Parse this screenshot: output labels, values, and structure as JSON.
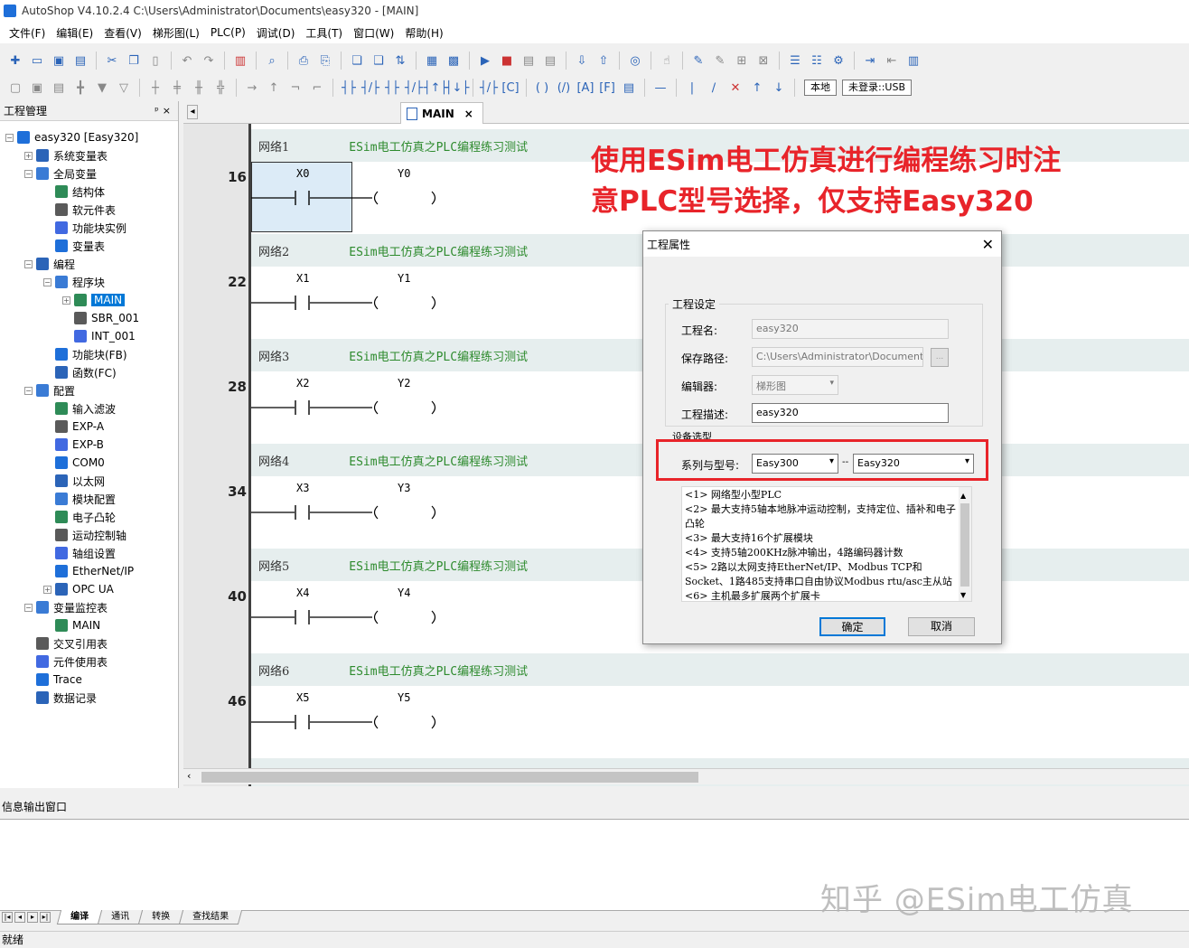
{
  "window": {
    "title": "AutoShop V4.10.2.4  C:\\Users\\Administrator\\Documents\\easy320 - [MAIN]"
  },
  "menu": [
    "文件(F)",
    "编辑(E)",
    "查看(V)",
    "梯形图(L)",
    "PLC(P)",
    "调试(D)",
    "工具(T)",
    "窗口(W)",
    "帮助(H)"
  ],
  "toolbar": {
    "local_label": "本地",
    "login_label": "未登录::USB"
  },
  "project_panel": {
    "title": "工程管理",
    "pin": "ᵖ",
    "close": "×",
    "tree": [
      {
        "label": "easy320 [Easy320]",
        "depth": 0,
        "exp": "−"
      },
      {
        "label": "系统变量表",
        "depth": 1,
        "exp": "+"
      },
      {
        "label": "全局变量",
        "depth": 1,
        "exp": "−"
      },
      {
        "label": "结构体",
        "depth": 2,
        "exp": ""
      },
      {
        "label": "软元件表",
        "depth": 2,
        "exp": ""
      },
      {
        "label": "功能块实例",
        "depth": 2,
        "exp": ""
      },
      {
        "label": "变量表",
        "depth": 2,
        "exp": ""
      },
      {
        "label": "编程",
        "depth": 1,
        "exp": "−"
      },
      {
        "label": "程序块",
        "depth": 2,
        "exp": "−"
      },
      {
        "label": "MAIN",
        "depth": 3,
        "exp": "+",
        "selected": true
      },
      {
        "label": "SBR_001",
        "depth": 3,
        "exp": ""
      },
      {
        "label": "INT_001",
        "depth": 3,
        "exp": ""
      },
      {
        "label": "功能块(FB)",
        "depth": 2,
        "exp": ""
      },
      {
        "label": "函数(FC)",
        "depth": 2,
        "exp": ""
      },
      {
        "label": "配置",
        "depth": 1,
        "exp": "−"
      },
      {
        "label": "输入滤波",
        "depth": 2,
        "exp": ""
      },
      {
        "label": "EXP-A",
        "depth": 2,
        "exp": ""
      },
      {
        "label": "EXP-B",
        "depth": 2,
        "exp": ""
      },
      {
        "label": "COM0",
        "depth": 2,
        "exp": ""
      },
      {
        "label": "以太网",
        "depth": 2,
        "exp": ""
      },
      {
        "label": "模块配置",
        "depth": 2,
        "exp": ""
      },
      {
        "label": "电子凸轮",
        "depth": 2,
        "exp": ""
      },
      {
        "label": "运动控制轴",
        "depth": 2,
        "exp": ""
      },
      {
        "label": "轴组设置",
        "depth": 2,
        "exp": ""
      },
      {
        "label": "EtherNet/IP",
        "depth": 2,
        "exp": ""
      },
      {
        "label": "OPC UA",
        "depth": 2,
        "exp": "+"
      },
      {
        "label": "变量监控表",
        "depth": 1,
        "exp": "−"
      },
      {
        "label": "MAIN",
        "depth": 2,
        "exp": ""
      },
      {
        "label": "交叉引用表",
        "depth": 1,
        "exp": ""
      },
      {
        "label": "元件使用表",
        "depth": 1,
        "exp": ""
      },
      {
        "label": "Trace",
        "depth": 1,
        "exp": ""
      },
      {
        "label": "数据记录",
        "depth": 1,
        "exp": ""
      }
    ]
  },
  "editor": {
    "tab_label": "MAIN",
    "tab_close": "×",
    "nav_arrow": "◂",
    "networks": [
      {
        "name": "网络1",
        "comment": "ESim电工仿真之PLC编程练习测试",
        "line": "16",
        "contact": "X0",
        "coil": "Y0",
        "selected": true
      },
      {
        "name": "网络2",
        "comment": "ESim电工仿真之PLC编程练习测试",
        "line": "22",
        "contact": "X1",
        "coil": "Y1"
      },
      {
        "name": "网络3",
        "comment": "ESim电工仿真之PLC编程练习测试",
        "line": "28",
        "contact": "X2",
        "coil": "Y2"
      },
      {
        "name": "网络4",
        "comment": "ESim电工仿真之PLC编程练习测试",
        "line": "34",
        "contact": "X3",
        "coil": "Y3"
      },
      {
        "name": "网络5",
        "comment": "ESim电工仿真之PLC编程练习测试",
        "line": "40",
        "contact": "X4",
        "coil": "Y4"
      },
      {
        "name": "网络6",
        "comment": "ESim电工仿真之PLC编程练习测试",
        "line": "46",
        "contact": "X5",
        "coil": "Y5"
      }
    ]
  },
  "annotation": {
    "line1": "使用ESim电工仿真进行编程练习时注",
    "line2": "意PLC型号选择，仅支持Easy320",
    "color": "#e8242a"
  },
  "dialog": {
    "title": "工程属性",
    "close": "✕",
    "group_label": "工程设定",
    "name_label": "工程名:",
    "name_value": "easy320",
    "path_label": "保存路径:",
    "path_value": "C:\\Users\\Administrator\\Documents\\ea",
    "browse_label": "...",
    "editor_label": "编辑器:",
    "editor_value": "梯形图",
    "desc_label": "工程描述:",
    "desc_value": "easy320",
    "device_label": "设备选型",
    "series_label": "系列与型号:",
    "series_value": "Easy300",
    "sep": "--",
    "model_value": "Easy320",
    "features": [
      "<1> 网络型小型PLC",
      "<2> 最大支持5轴本地脉冲运动控制，支持定位、插补和电子凸轮",
      "<3> 最大支持16个扩展模块",
      "<4> 支持5轴200KHz脉冲输出，4路编码器计数",
      "<5> 2路以太网支持EtherNet/IP、Modbus TCP和Socket、1路485支持串口自由协议Modbus rtu/asc主从站",
      "<6> 主机最多扩展两个扩展卡"
    ],
    "ok_label": "确定",
    "cancel_label": "取消"
  },
  "info_panel": {
    "title": "信息输出窗口",
    "tabs": [
      "编译",
      "通讯",
      "转换",
      "查找结果"
    ]
  },
  "watermark": "知乎 @ESim电工仿真",
  "status": {
    "text": "就绪"
  }
}
